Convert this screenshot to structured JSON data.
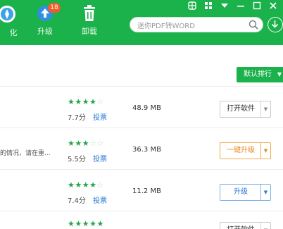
{
  "toolbar": {
    "partial_label": "化",
    "upgrade_label": "升级",
    "upgrade_badge": "18",
    "uninstall_label": "卸载"
  },
  "search": {
    "placeholder": "迷你PDF转WORD"
  },
  "sort": {
    "label": "默认排行"
  },
  "rows": [
    {
      "stars": 3.5,
      "score": "7.7分",
      "rate_label": "投票",
      "size": "48.9 MB",
      "action": "打开软件",
      "action_style": "gray",
      "desc": ""
    },
    {
      "stars": 2.5,
      "score": "5.5分",
      "rate_label": "投票",
      "size": "36.3 MB",
      "action": "一键升级",
      "action_style": "orange",
      "desc": "的情况，请在重..."
    },
    {
      "stars": 3.5,
      "score": "7.4分",
      "rate_label": "投票",
      "size": "11.2 MB",
      "action": "升级",
      "action_style": "blue",
      "desc": ""
    },
    {
      "stars": 4.5,
      "score": "",
      "rate_label": "",
      "size": "",
      "action": "打开软件",
      "action_style": "gray",
      "desc": ""
    }
  ],
  "colors": {
    "brand_green": "#1bb14b",
    "link_blue": "#2a7ad6",
    "upgrade_orange": "#e8871e",
    "badge_red": "#f35b2b"
  }
}
